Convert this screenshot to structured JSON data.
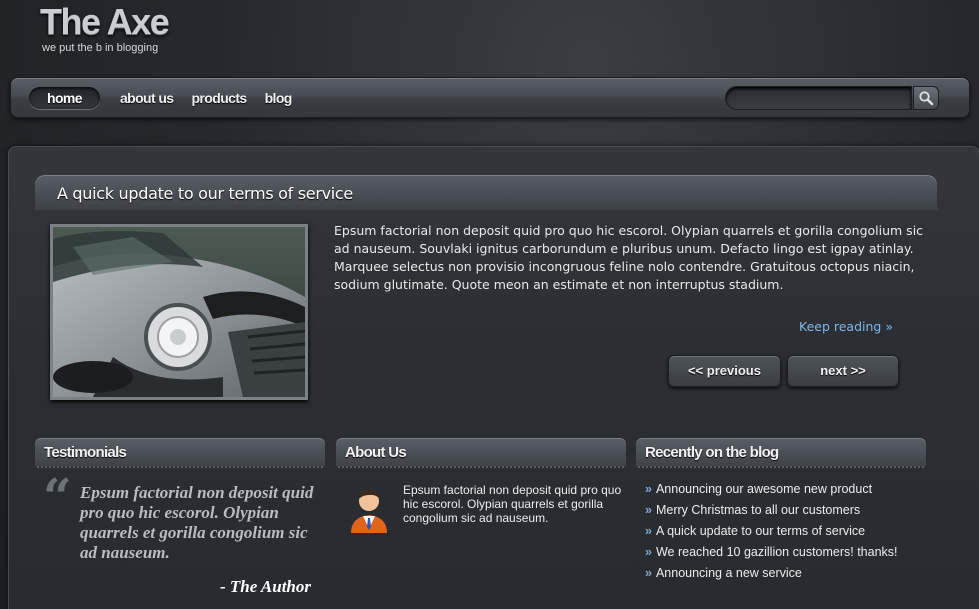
{
  "logo": {
    "title": "The Axe",
    "tagline": "we put the b in blogging"
  },
  "nav": {
    "items": [
      {
        "label": "home",
        "active": true
      },
      {
        "label": "about us",
        "active": false
      },
      {
        "label": "products",
        "active": false
      },
      {
        "label": "blog",
        "active": false
      }
    ],
    "search": {
      "value": "",
      "placeholder": ""
    }
  },
  "post": {
    "title": "A quick update to our terms of service",
    "body": "Epsum factorial non deposit quid pro quo hic escorol. Olypian quarrels et gorilla congolium sic ad nauseum. Souvlaki ignitus carborundum e pluribus unum. Defacto lingo est igpay atinlay. Marquee selectus non provisio incongruous feline nolo contendre. Gratuitous octopus niacin, sodium glutimate. Quote meon an estimate et non interruptus stadium.",
    "keep_reading": "Keep reading »",
    "previous_label": "<< previous",
    "next_label": "next >>"
  },
  "testimonials": {
    "heading": "Testimonials",
    "quote": "Epsum factorial non deposit quid pro quo hic escorol. Olypian quarrels et gorilla congolium sic ad nauseum.",
    "author": "- The Author"
  },
  "about": {
    "heading": "About Us",
    "text": "Epsum factorial non deposit quid pro quo hic escorol. Olypian quarrels et gorilla congolium sic ad nauseum."
  },
  "blog": {
    "heading": "Recently on the blog",
    "items": [
      "Announcing our awesome new product",
      "Merry Christmas to all our customers",
      "A quick update to our terms of service",
      "We reached 10 gazillion customers! thanks!",
      "Announcing a new service"
    ]
  },
  "colors": {
    "accent_link": "#7fb6e8",
    "background": "#25282c",
    "panel": "#2b2f33"
  },
  "icons": {
    "search": "magnifier-icon",
    "quote": "quote-mark-icon",
    "avatar": "person-avatar-icon"
  }
}
